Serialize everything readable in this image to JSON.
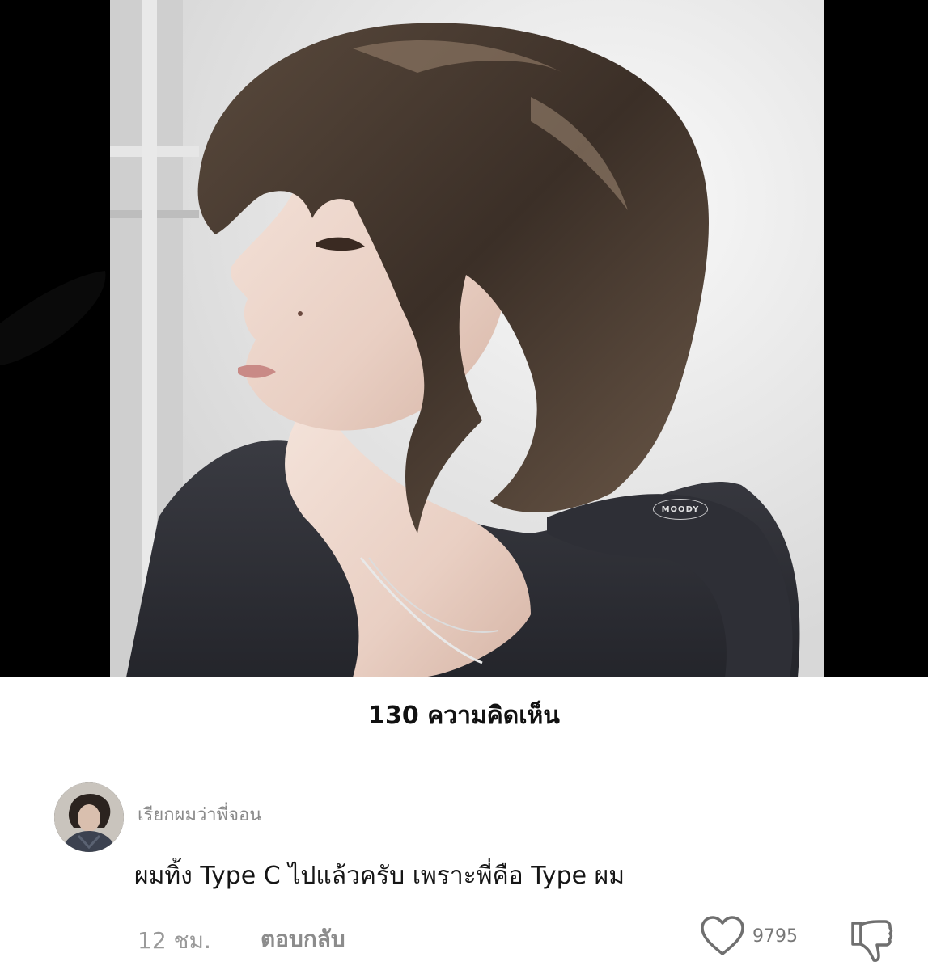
{
  "media": {
    "watermark_text": "MOODY",
    "background_color": "#000000"
  },
  "comments_section": {
    "count_title": "130 ความคิดเห็น"
  },
  "comment": {
    "username": "เรียกผมว่าพี่จอน",
    "text": "ผมทิ้ง Type C ไปแล้วครับ เพราะพี่คือ Type ผม",
    "timestamp": "12 ชม.",
    "reply_label": "ตอบกลับ",
    "like_count": "9795",
    "icons": {
      "like": "heart-outline-icon",
      "dislike": "thumbs-down-outline-icon"
    }
  }
}
